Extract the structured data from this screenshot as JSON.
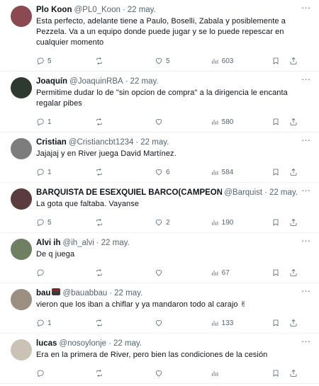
{
  "tweets": [
    {
      "name": "Plo Koon",
      "handle": "@PL0_Koon",
      "sep": "·",
      "date": "22 may.",
      "text": "Esta perfecto, adelante tiene a Paulo, Boselli, Zabala y posiblemente a Pezzela. Va a un equipo donde puede jugar y se lo puede repescar en cualquier momento",
      "replies": "5",
      "retweets": "",
      "likes": "5",
      "views": "603",
      "avatar_color": "#8a4a4f"
    },
    {
      "name": "Joaquín",
      "handle": "@JoaquinRBA",
      "sep": "·",
      "date": "22 may.",
      "text": "Permitime dudar lo de \"sin opcion de compra\" a la dirigencia le encanta regalar pibes",
      "replies": "1",
      "retweets": "",
      "likes": "",
      "views": "580",
      "avatar_color": "#2e3a30"
    },
    {
      "name": "Cristian",
      "handle": "@Cristiancbt1234",
      "sep": "·",
      "date": "22 may.",
      "text": "Jajajaj y en River juega David Martínez.",
      "replies": "1",
      "retweets": "",
      "likes": "6",
      "views": "584",
      "avatar_color": "#7d7d7d"
    },
    {
      "name": "BARQUISTA DE ESEXQUIEL BARCO(CAMPEON DE",
      "handle": "@Barquist",
      "sep": "·",
      "date": "22 may.",
      "text": "La gota que faltaba. Vayanse",
      "replies": "5",
      "retweets": "",
      "likes": "2",
      "views": "190",
      "avatar_color": "#5a3b3e"
    },
    {
      "name": "Alvi ih",
      "handle": "@ih_alvi",
      "sep": "·",
      "date": "22 may.",
      "text": "De q juega",
      "replies": "",
      "retweets": "",
      "likes": "",
      "views": "67",
      "avatar_color": "#6f7f62"
    },
    {
      "name": "bau",
      "handle": "@bauabbau",
      "sep": "·",
      "date": "22 may.",
      "text": "vieron que los iban a chiflar y ya mandaron todo al carajo",
      "emoji": "✌",
      "replies": "1",
      "retweets": "",
      "likes": "",
      "views": "133",
      "avatar_color": "#9a8f80"
    },
    {
      "name": "lucas",
      "handle": "@nosoylonje",
      "sep": "·",
      "date": "22 may.",
      "text": "Era en la primera de River, pero bien las condiciones de la cesión",
      "replies": "",
      "retweets": "",
      "likes": "",
      "views": "",
      "avatar_color": "#c9c2b5"
    }
  ],
  "icons": {
    "more": "more-icon",
    "reply": "reply-icon",
    "retweet": "retweet-icon",
    "like": "heart-icon",
    "views": "views-icon",
    "bookmark": "bookmark-icon",
    "share": "share-icon"
  }
}
